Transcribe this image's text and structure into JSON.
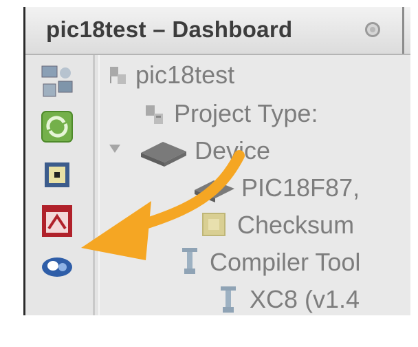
{
  "window": {
    "title": "pic18test – Dashboard"
  },
  "tree": {
    "rows": [
      {
        "label": "pic18test",
        "icon": "project-icon"
      },
      {
        "label": "Project Type:",
        "icon": "project-type-icon"
      },
      {
        "label": "Device",
        "icon": "chip-icon"
      },
      {
        "label": "PIC18F87,",
        "icon": "chip-icon"
      },
      {
        "label": "Checksum",
        "icon": "checksum-icon"
      },
      {
        "label": "Compiler Tool",
        "icon": "compiler-icon"
      },
      {
        "label": "XC8 (v1.4",
        "icon": "compiler-icon"
      }
    ]
  },
  "sidebar": {
    "buttons": [
      {
        "name": "network-icon"
      },
      {
        "name": "refresh-icon"
      },
      {
        "name": "chip-select-icon"
      },
      {
        "name": "pdf-icon"
      },
      {
        "name": "info-icon"
      }
    ]
  },
  "colors": {
    "arrow": "#f5a623"
  }
}
